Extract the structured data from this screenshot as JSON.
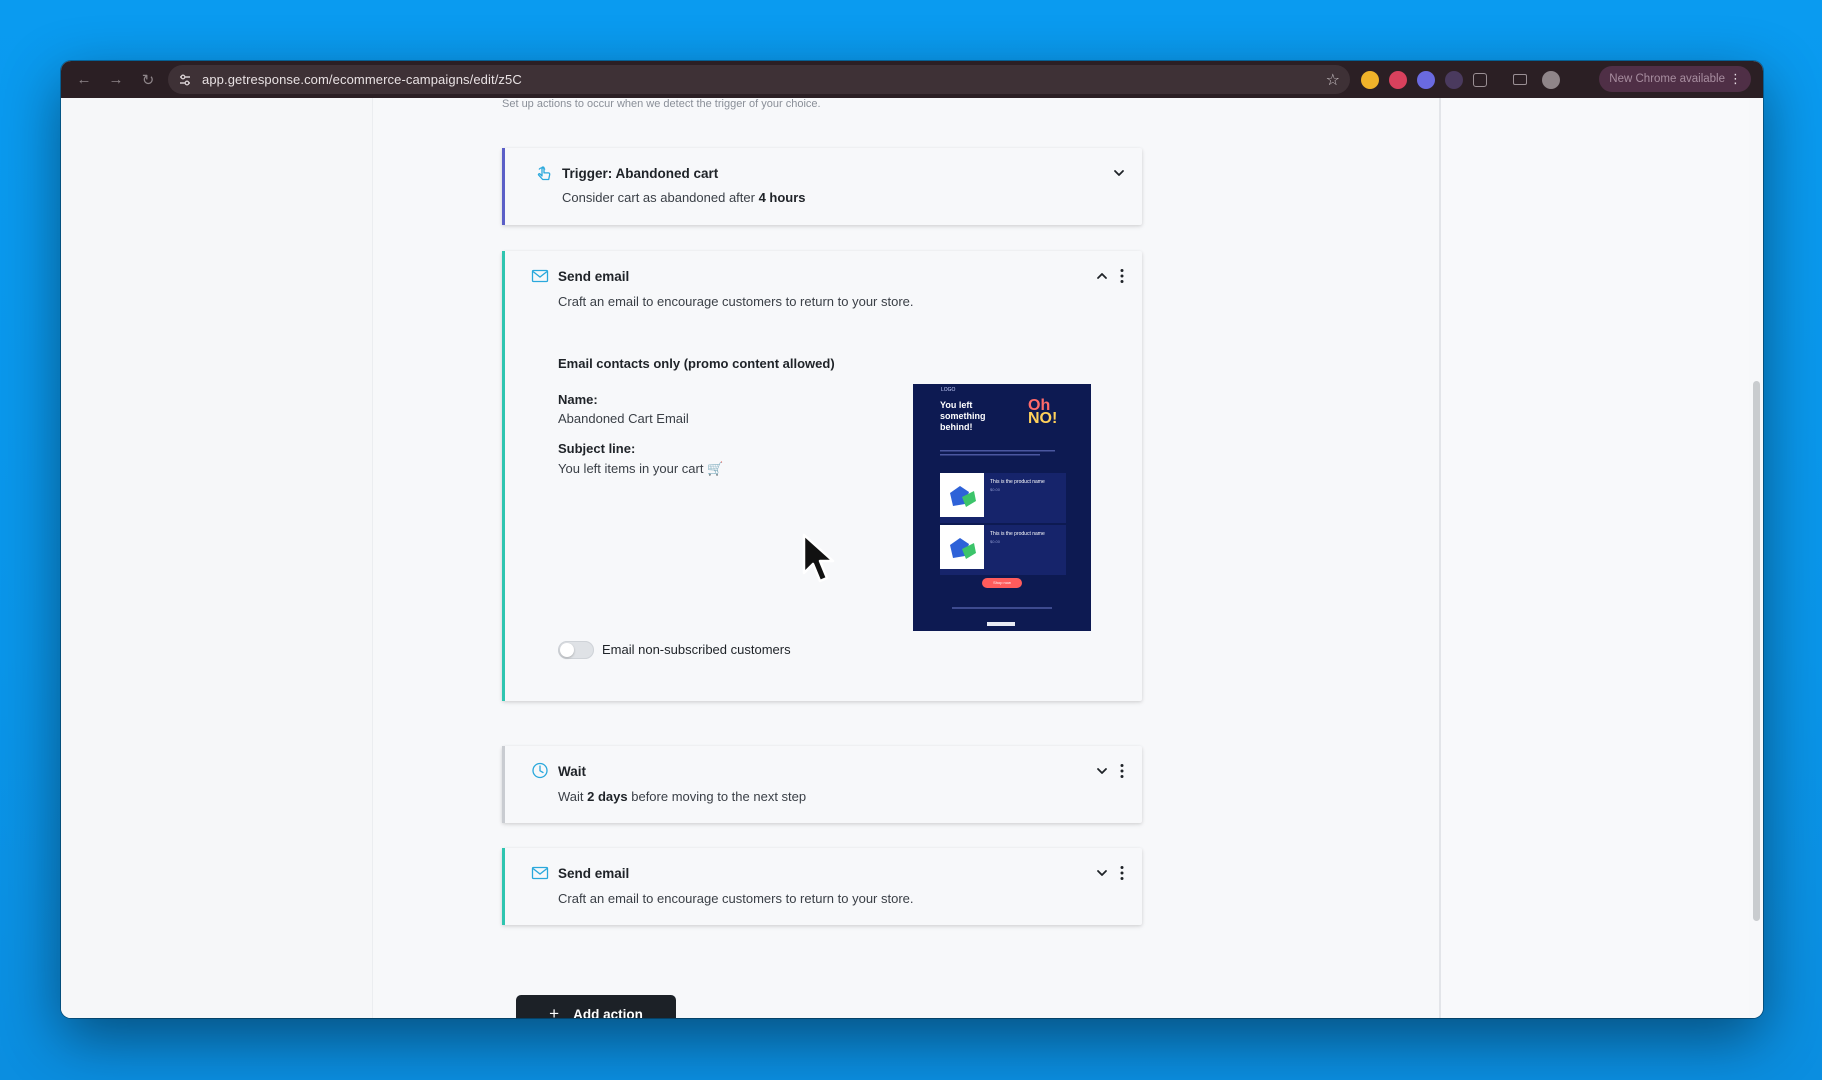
{
  "browser": {
    "url": "app.getresponse.com/ecommerce-campaigns/edit/z5C",
    "update_label": "New Chrome available",
    "icons": [
      "back-arrow-icon",
      "forward-arrow-icon",
      "reload-icon",
      "site-settings-icon",
      "star-icon",
      "extension-icon",
      "profile-icon",
      "kebab-menu-icon"
    ]
  },
  "page": {
    "hint": "Set up actions to occur when we detect the trigger of your choice."
  },
  "trigger": {
    "title": "Trigger: Abandoned cart",
    "subtitle_prefix": "Consider cart as abandoned after ",
    "subtitle_bold": "4 hours",
    "accent": "#5b5fc7"
  },
  "send_email_1": {
    "title": "Send email",
    "subtitle": "Craft an email to encourage customers to return to your store.",
    "section_title": "Email contacts only (promo content allowed)",
    "name_label": "Name:",
    "name_value": "Abandoned Cart Email",
    "subject_label": "Subject line:",
    "subject_value": "You left items in your cart 🛒",
    "toggle_label": "Email non-subscribed customers",
    "toggle_on": false,
    "accent": "#2ec5b0",
    "preview": {
      "logo": "LOGO",
      "headline": "You left something behind!",
      "oh": "Oh",
      "no": "NO!",
      "product_name": "This is the product name",
      "product_price": "$0.00",
      "button": "Shop now",
      "bg": "#0d1a52"
    }
  },
  "wait": {
    "title": "Wait",
    "subtitle_prefix": "Wait ",
    "subtitle_bold": "2 days",
    "subtitle_suffix": " before moving to the next step",
    "accent": "#c9ccd1"
  },
  "send_email_2": {
    "title": "Send email",
    "subtitle": "Craft an email to encourage customers to return to your store.",
    "accent": "#2ec5b0"
  },
  "add_action": {
    "label": "Add action"
  }
}
